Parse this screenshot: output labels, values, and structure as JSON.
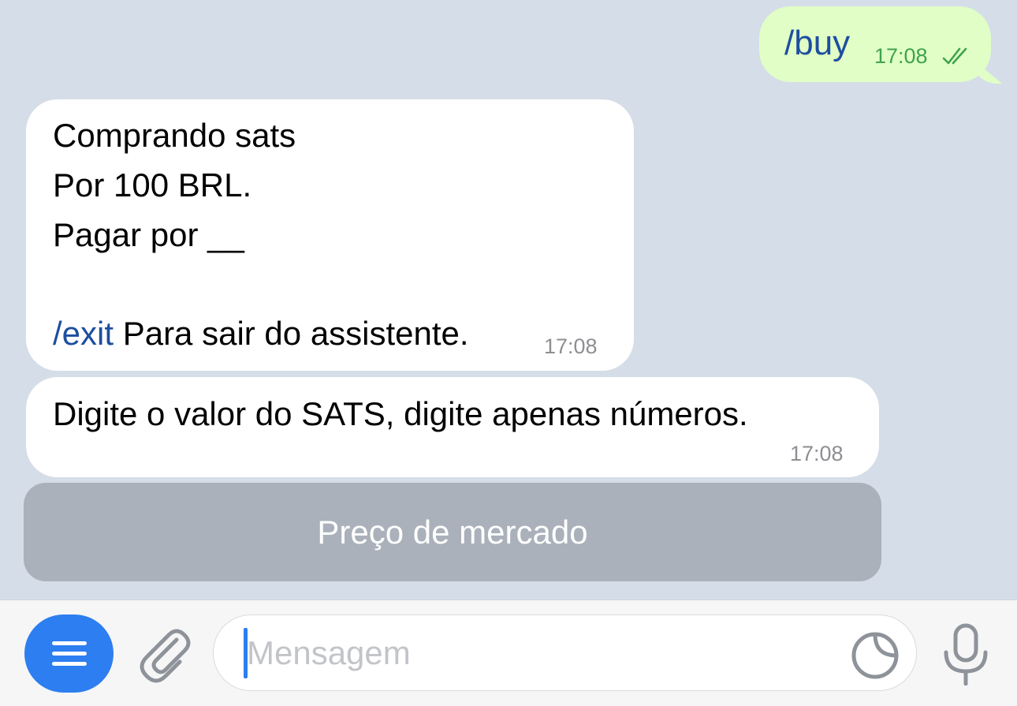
{
  "messages": {
    "outgoing": {
      "text": "/buy",
      "time": "17:08",
      "status_icon": "double-check-icon"
    },
    "incoming": [
      {
        "lines": [
          "Comprando sats",
          "Por 100 BRL.",
          "Pagar por __"
        ],
        "command": "/exit",
        "command_rest": " Para sair do assistente.",
        "time": "17:08"
      },
      {
        "text": "Digite o valor do SATS, digite apenas números.",
        "time": "17:08"
      }
    ]
  },
  "keyboard": {
    "button_label": "Preço de mercado"
  },
  "input": {
    "placeholder": "Mensagem",
    "menu_icon": "menu-icon",
    "attach_icon": "paperclip-icon",
    "sticker_icon": "sticker-icon",
    "mic_icon": "microphone-icon"
  },
  "colors": {
    "background": "#d5dde8",
    "outgoing_bubble": "#e1fec6",
    "incoming_bubble": "#ffffff",
    "link": "#1d4ea0",
    "accent": "#2d7ef0",
    "keyboard_button": "#aab1ba"
  }
}
